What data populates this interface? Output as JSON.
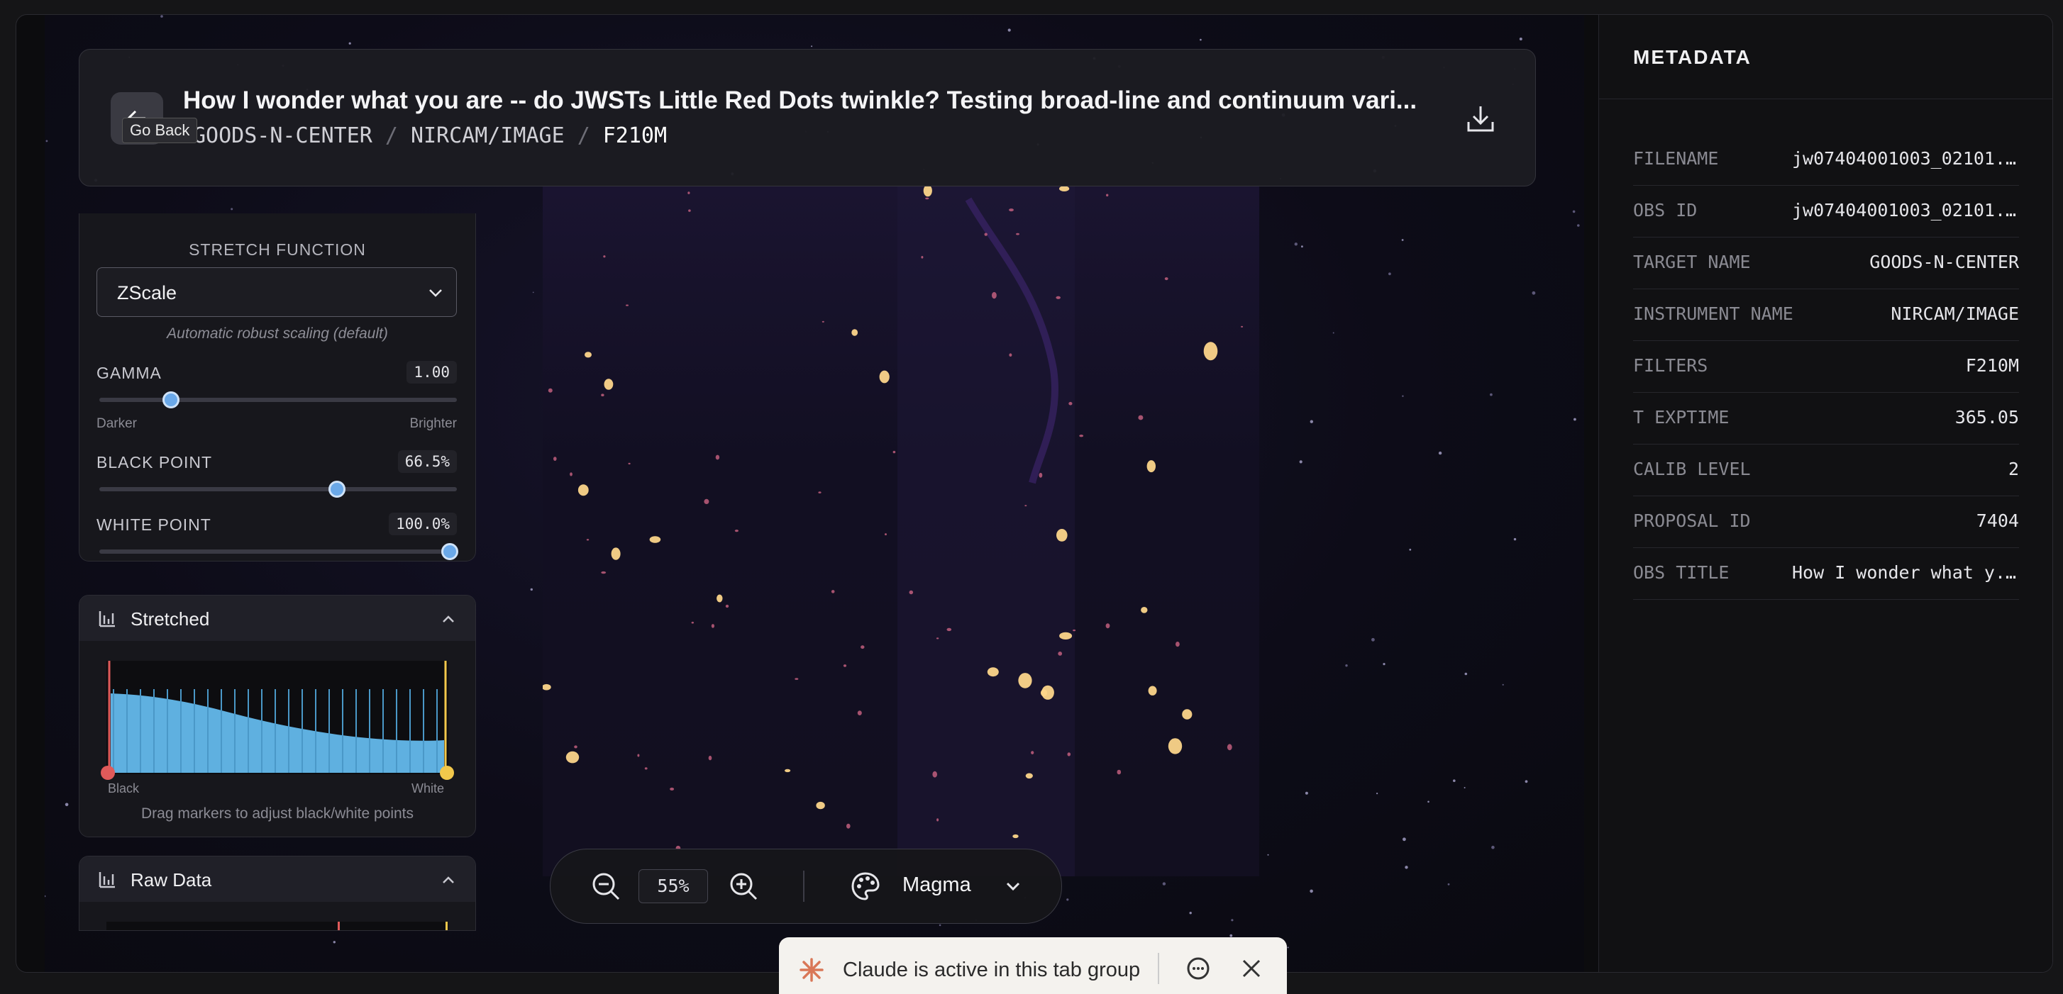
{
  "header": {
    "back_tooltip": "Go Back",
    "back_icon": "arrow-left-icon",
    "title": "How I wonder what you are -- do JWSTs Little Red Dots twinkle? Testing broad-line and continuum vari...",
    "breadcrumb": [
      "GOODS-N-CENTER",
      "NIRCAM/IMAGE",
      "F210M"
    ],
    "breadcrumb_sep": "/",
    "download_icon": "download-icon"
  },
  "controls": {
    "stretch_label": "STRETCH FUNCTION",
    "stretch_value": "ZScale",
    "stretch_hint": "Automatic robust scaling (default)",
    "gamma": {
      "label": "GAMMA",
      "value": "1.00",
      "level": 0.2,
      "low": "Darker",
      "high": "Brighter"
    },
    "black_point": {
      "label": "BLACK POINT",
      "value": "66.5%",
      "level": 0.665
    },
    "white_point": {
      "label": "WHITE POINT",
      "value": "100.0%",
      "level": 1.0
    }
  },
  "histogram_stretched": {
    "title": "Stretched",
    "black_label": "Black",
    "white_label": "White",
    "footer": "Drag markers to adjust black/white points"
  },
  "histogram_raw": {
    "title": "Raw Data"
  },
  "toolbar": {
    "zoom": "55%",
    "colormap": "Magma",
    "icons": [
      "zoom-out-icon",
      "zoom-in-icon",
      "palette-icon",
      "chevron-down-icon"
    ]
  },
  "metadata": {
    "title": "METADATA",
    "rows": [
      {
        "key": "FILENAME",
        "value": "jw07404001003_02101..."
      },
      {
        "key": "OBS ID",
        "value": "jw07404001003_02101..."
      },
      {
        "key": "TARGET NAME",
        "value": "GOODS-N-CENTER"
      },
      {
        "key": "INSTRUMENT NAME",
        "value": "NIRCAM/IMAGE"
      },
      {
        "key": "FILTERS",
        "value": "F210M"
      },
      {
        "key": "T EXPTIME",
        "value": "365.05"
      },
      {
        "key": "CALIB LEVEL",
        "value": "2"
      },
      {
        "key": "PROPOSAL ID",
        "value": "7404"
      },
      {
        "key": "OBS TITLE",
        "value": "How I wonder what y..."
      }
    ]
  },
  "claude_bar": {
    "text": "Claude is active in this tab group"
  },
  "colors": {
    "accent_blue": "#6aa8e8",
    "black_marker": "#e05a5a",
    "white_marker": "#f2c84b",
    "hist_fill": "#5fb0e0"
  }
}
